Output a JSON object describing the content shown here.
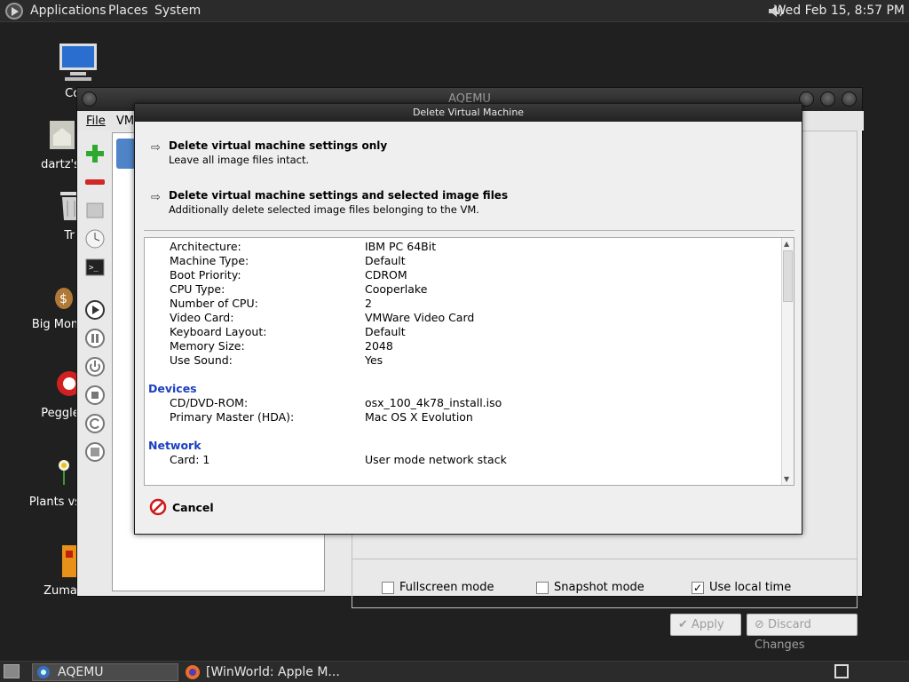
{
  "top_panel": {
    "menus": [
      "Applications",
      "Places",
      "System"
    ],
    "clock": "Wed Feb 15,  8:57 PM",
    "icons": {
      "logo": "distro-logo-icon",
      "volume": "speaker-volume-icon"
    }
  },
  "desktop_icons": [
    {
      "label": "Com",
      "icon": "computer-icon"
    },
    {
      "label": "dartz's",
      "icon": "home-folder-icon"
    },
    {
      "label": "Tr",
      "icon": "trash-icon"
    },
    {
      "label": "Big Mon",
      "icon": "money-bag-icon"
    },
    {
      "label": "Peggle",
      "icon": "peggle-icon"
    },
    {
      "label": "Plants vs",
      "icon": "flower-icon"
    },
    {
      "label": "Zuma",
      "icon": "zuma-icon"
    }
  ],
  "main_window": {
    "title": "AQEMU",
    "menu": [
      "File",
      "VM"
    ],
    "checkboxes": [
      {
        "label": "Fullscreen mode",
        "checked": false
      },
      {
        "label": "Snapshot mode",
        "checked": false
      },
      {
        "label": "Use local time",
        "checked": true
      }
    ],
    "apply_label": "Apply",
    "discard_label": "Discard Changes"
  },
  "dialog": {
    "title": "Delete Virtual Machine",
    "option1": {
      "heading": "Delete virtual machine settings only",
      "description": "Leave all image files intact."
    },
    "option2": {
      "heading": "Delete virtual machine settings and selected image files",
      "description": "Additionally delete selected image files belonging to the VM."
    },
    "details": [
      {
        "key": "Architecture:",
        "value": "IBM PC 64Bit"
      },
      {
        "key": "Machine Type:",
        "value": "Default"
      },
      {
        "key": "Boot Priority:",
        "value": "CDROM"
      },
      {
        "key": "CPU Type:",
        "value": "Cooperlake"
      },
      {
        "key": "Number of CPU:",
        "value": "2"
      },
      {
        "key": "Video Card:",
        "value": "VMWare Video Card"
      },
      {
        "key": "Keyboard Layout:",
        "value": "Default"
      },
      {
        "key": "Memory Size:",
        "value": "2048"
      },
      {
        "key": "Use Sound:",
        "value": "Yes"
      }
    ],
    "devices_heading": "Devices",
    "devices": [
      {
        "key": "CD/DVD-ROM:",
        "value": "osx_100_4k78_install.iso"
      },
      {
        "key": "Primary Master (HDA):",
        "value": "Mac OS X Evolution"
      }
    ],
    "network_heading": "Network",
    "network": [
      {
        "key": "Card: 1",
        "value": "User mode network stack"
      }
    ],
    "cancel_label": "Cancel"
  },
  "taskbar": {
    "items": [
      {
        "label": "AQEMU",
        "icon": "aqemu-icon"
      },
      {
        "label": "[WinWorld: Apple M...",
        "icon": "firefox-icon"
      }
    ]
  }
}
